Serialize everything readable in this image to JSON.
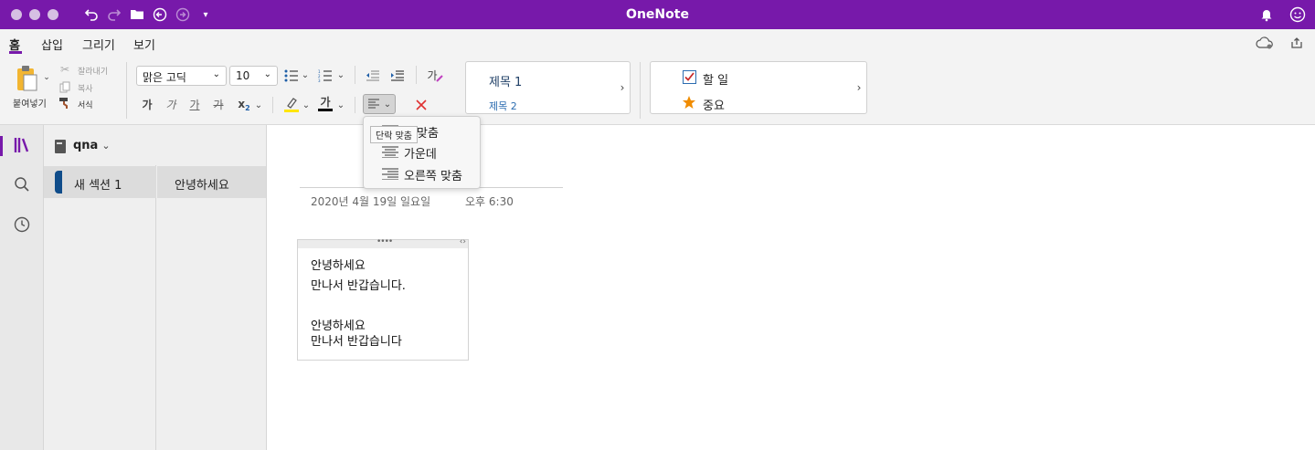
{
  "window": {
    "title": "OneNote"
  },
  "menu_tabs": [
    {
      "label": "홈",
      "active": true
    },
    {
      "label": "삽입",
      "active": false
    },
    {
      "label": "그리기",
      "active": false
    },
    {
      "label": "보기",
      "active": false
    }
  ],
  "clipboard": {
    "paste_label": "붙여넣기",
    "cut_label": "잘라내기",
    "copy_label": "복사",
    "format_label": "서식"
  },
  "font": {
    "family": "맑은 고딕",
    "size": "10",
    "bold_glyph": "가",
    "italic_glyph": "가",
    "underline_glyph": "가",
    "strike_glyph": "가",
    "subscript_glyph": "x",
    "subscript_suffix": "2",
    "font_color_glyph": "가",
    "clear_glyph": "가",
    "highlight_color": "#ffe600",
    "font_color": "#000000",
    "clear_formatting_color": "#e03131"
  },
  "styles": {
    "heading1": "제목 1",
    "heading2": "제목 2"
  },
  "tags": {
    "todo": "할 일",
    "important": "중요"
  },
  "align_dropdown": {
    "tooltip": "단락 맞춤",
    "items": [
      {
        "label": "맞춤",
        "icon": "align-left-icon"
      },
      {
        "label": "가운데",
        "icon": "align-center-icon"
      },
      {
        "label": "오른쪽 맞춤",
        "icon": "align-right-icon"
      }
    ]
  },
  "notebook": {
    "name": "qna",
    "sections": [
      {
        "label": "새 섹션 1",
        "color": "#0f4c8a"
      }
    ],
    "pages": [
      {
        "label": "안녕하세요"
      }
    ]
  },
  "page": {
    "date": "2020년 4월 19일 일요일",
    "time": "오후 6:30",
    "note_lines": [
      "안녕하세요",
      "만나서 반갑습니다.",
      "",
      "안녕하세요",
      "만나서 반갑습니다"
    ]
  },
  "colors": {
    "accent": "#7719aa",
    "todo_check": "#2b6cb0",
    "important_star": "#f08c00"
  }
}
